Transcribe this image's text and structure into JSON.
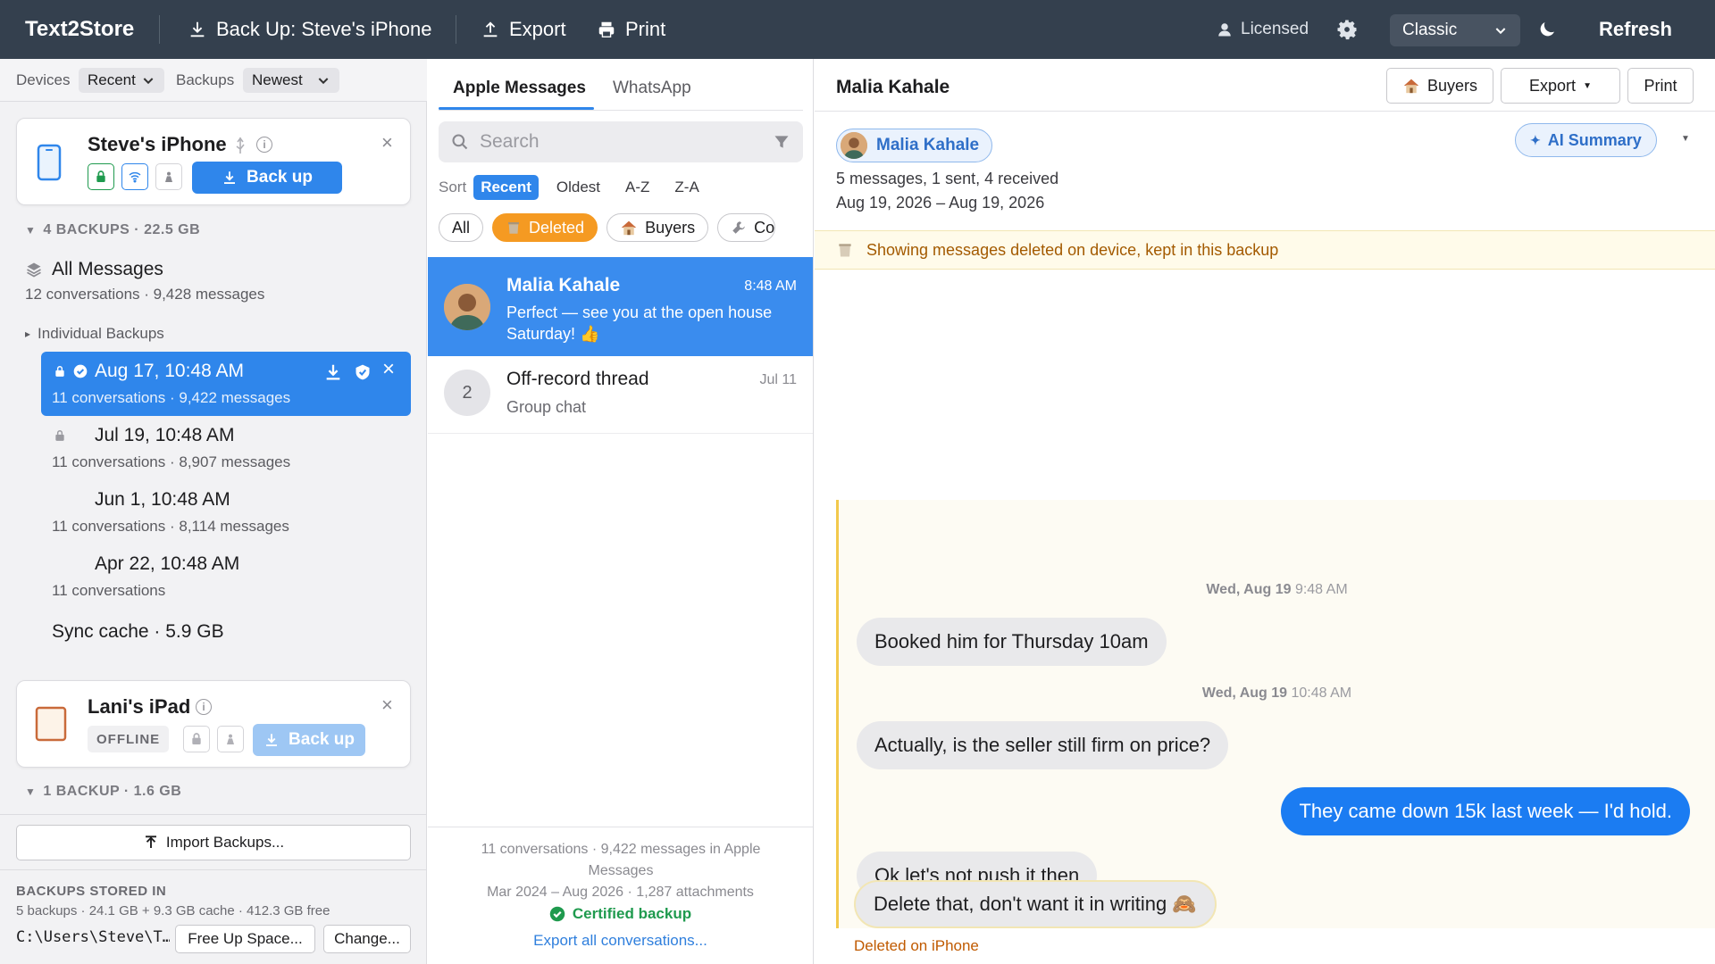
{
  "toolbar": {
    "app_title": "Text2Store",
    "backup_label": "Back Up: Steve's iPhone",
    "export_label": "Export",
    "print_label": "Print",
    "license_label": "Licensed",
    "theme_value": "Classic",
    "refresh_label": "Refresh"
  },
  "left": {
    "devices_label": "Devices",
    "devices_filter": "Recent",
    "backups_label": "Backups",
    "backups_filter": "Newest",
    "device1": {
      "name": "Steve's iPhone",
      "backup_button": "Back up",
      "backups_header": "4 BACKUPS · 22.5 GB"
    },
    "all_messages": {
      "title": "All Messages",
      "sub": "12 conversations · 9,428 messages"
    },
    "individual_header": "Individual Backups",
    "backups": [
      {
        "title": "Aug 17, 10:48 AM",
        "sub": "11 conversations · 9,422 messages"
      },
      {
        "title": "Jul 19, 10:48 AM",
        "sub": "11 conversations · 8,907 messages"
      },
      {
        "title": "Jun 1, 10:48 AM",
        "sub": "11 conversations · 8,114 messages"
      },
      {
        "title": "Apr 22, 10:48 AM",
        "sub": "11 conversations"
      }
    ],
    "sync_cache": "Sync cache · 5.9 GB",
    "device2": {
      "name": "Lani's iPad",
      "status": "OFFLINE",
      "backup_button": "Back up",
      "backups_header": "1 BACKUP · 1.6 GB"
    },
    "import_button": "Import Backups...",
    "storage": {
      "header": "BACKUPS STORED IN",
      "sub": "5 backups · 24.1 GB + 9.3 GB cache · 412.3 GB free",
      "path": "C:\\Users\\Steve\\T…",
      "free_up_button": "Free Up Space...",
      "change_button": "Change..."
    }
  },
  "middle": {
    "tabs": [
      {
        "label": "Apple Messages"
      },
      {
        "label": "WhatsApp"
      }
    ],
    "search_placeholder": "Search",
    "sort_label": "Sort",
    "sort_options": [
      "Recent",
      "Oldest",
      "A-Z",
      "Z-A"
    ],
    "chips": [
      "All",
      "Deleted",
      "Buyers",
      "Co"
    ],
    "conversations": [
      {
        "name": "Malia Kahale",
        "time": "8:48 AM",
        "preview": "Perfect — see you at the open house Saturday! 👍"
      },
      {
        "name": "Off-record thread",
        "time": "Jul 11",
        "preview": "Group chat",
        "avatar_number": "2"
      }
    ],
    "footer_line1": "11 conversations · 9,422 messages in Apple Messages",
    "footer_line2": "Mar 2024 – Aug 2026 · 1,287 attachments",
    "certified": "Certified backup",
    "export_all": "Export all conversations..."
  },
  "right": {
    "title": "Malia Kahale",
    "buyers_button": "Buyers",
    "export_button": "Export",
    "print_button": "Print",
    "contact_pill": "Malia Kahale",
    "ai_summary": "AI Summary",
    "meta_line1": "5 messages, 1 sent, 4 received",
    "meta_line2": "Aug 19, 2026 – Aug 19, 2026",
    "banner": "Showing messages deleted on device, kept in this backup",
    "date1_day": "Wed, Aug 19",
    "date1_time": "9:48 AM",
    "date2_day": "Wed, Aug 19",
    "date2_time": "10:48 AM",
    "messages": [
      {
        "text": "Booked him for Thursday 10am",
        "direction": "in"
      },
      {
        "text": "Actually, is the seller still firm on price?",
        "direction": "in"
      },
      {
        "text": "They came down 15k last week — I'd hold.",
        "direction": "out"
      },
      {
        "text": "Ok let's not push it then",
        "direction": "in"
      },
      {
        "text": "Delete that, don't want it in writing 🙈",
        "direction": "in"
      }
    ],
    "deleted_note": "Deleted on iPhone"
  },
  "colors": {
    "toolbar_bg": "#34404e",
    "accent_blue": "#2f86eb",
    "deleted_orange": "#f59a22",
    "banner_text": "#a35a00"
  }
}
